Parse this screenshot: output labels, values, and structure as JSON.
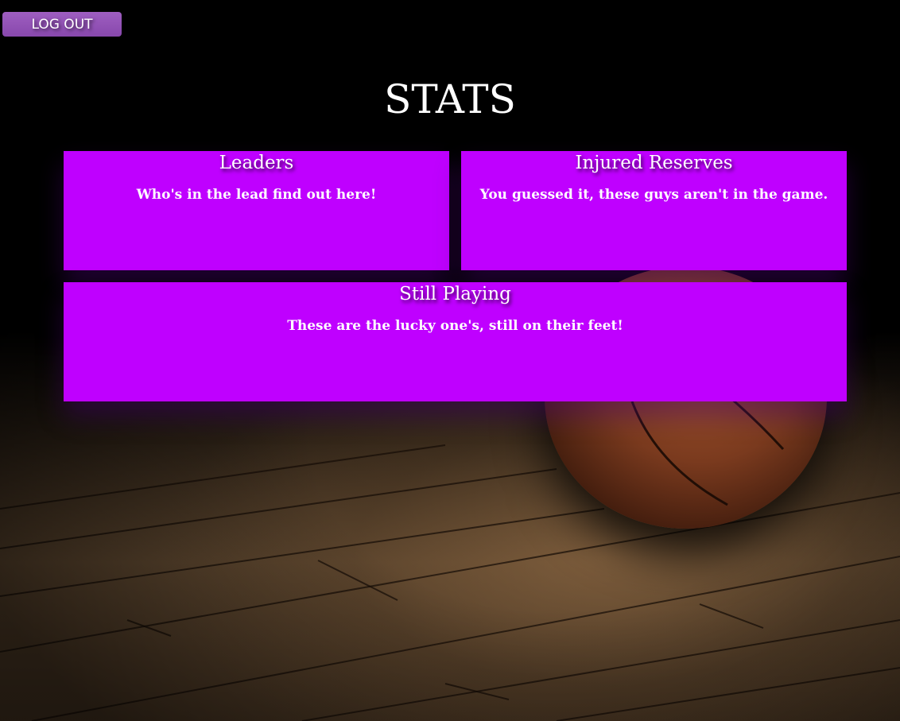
{
  "header": {
    "logout_label": "LOG OUT",
    "title": "STATS"
  },
  "panels": [
    {
      "heading": "Leaders",
      "text": "Who's in the lead find out here!"
    },
    {
      "heading": "Injured Reserves",
      "text": "You guessed it, these guys aren't in the game."
    },
    {
      "heading": "Still Playing",
      "text": "These are the lucky one's, still on their feet!"
    }
  ],
  "colors": {
    "panel_background": "#bf00ff",
    "logout_button": "#9e5ec0",
    "text": "#ffffff",
    "page_background": "#000000"
  }
}
